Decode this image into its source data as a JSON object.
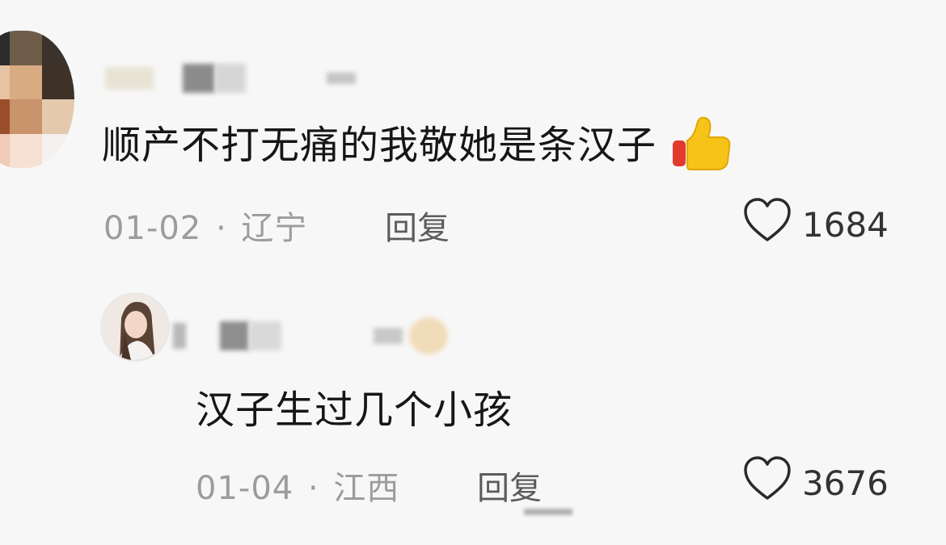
{
  "comments": [
    {
      "text": "顺产不打无痛的我敬她是条汉子",
      "emoji": "thumbs-up",
      "date": "01-02",
      "separator": "·",
      "location": "辽宁",
      "reply_label": "回复",
      "like_icon": "heart-outline-icon",
      "likes": "1684"
    },
    {
      "text": "汉子生过几个小孩",
      "date": "01-04",
      "separator": "·",
      "location": "江西",
      "reply_label": "回复",
      "like_icon": "heart-outline-icon",
      "likes": "3676"
    }
  ],
  "colors": {
    "background": "#f7f7f7",
    "comment_text": "#161616",
    "meta_text": "#9c9c9c",
    "reply_text": "#5c5c5c"
  }
}
